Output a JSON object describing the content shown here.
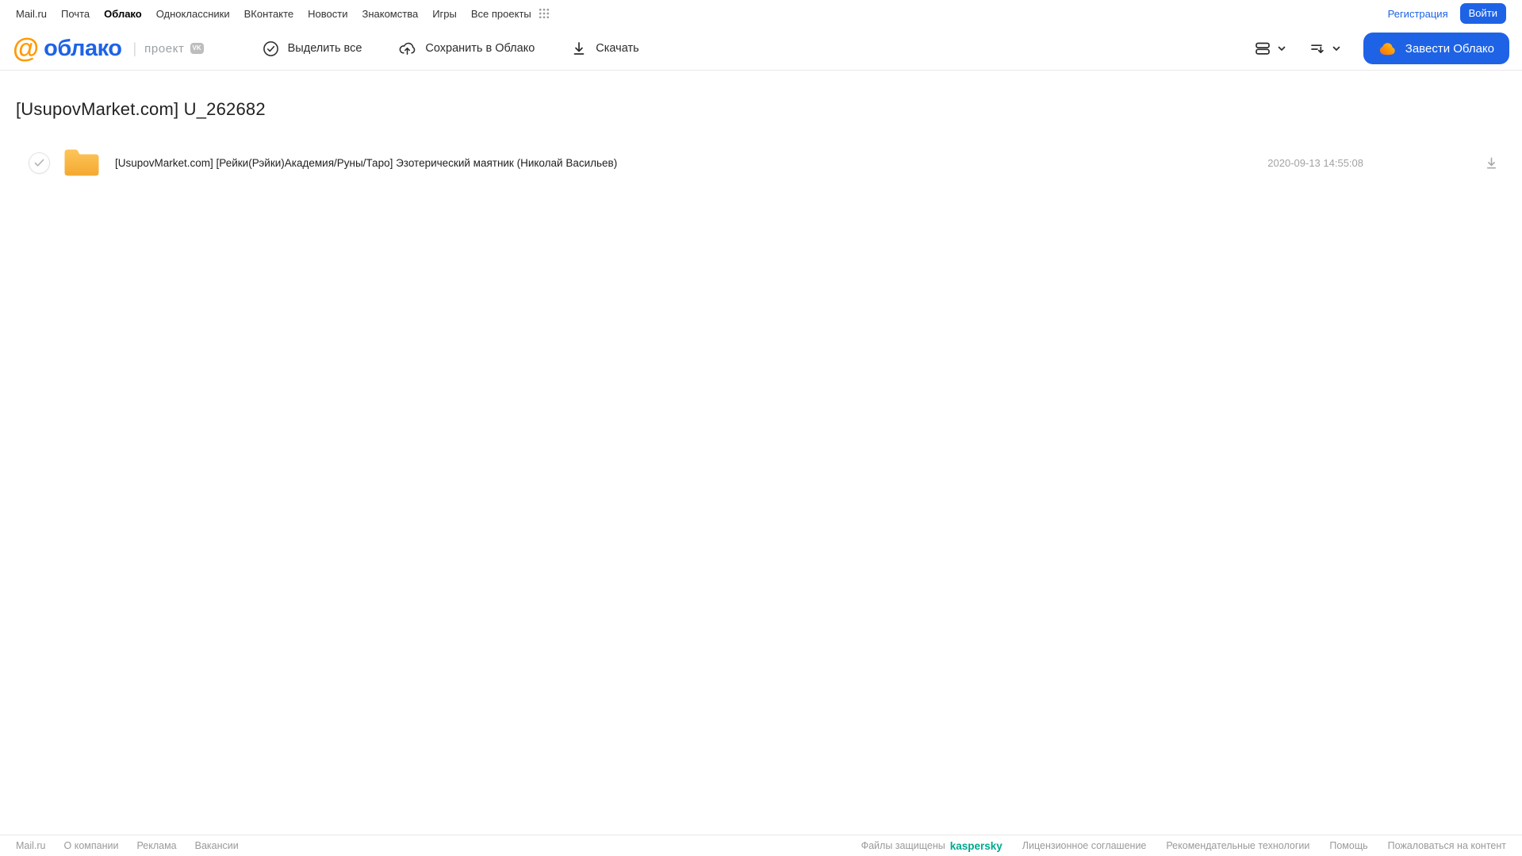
{
  "topnav": {
    "links": [
      {
        "label": "Mail.ru",
        "active": false
      },
      {
        "label": "Почта",
        "active": false
      },
      {
        "label": "Облако",
        "active": true
      },
      {
        "label": "Одноклассники",
        "active": false
      },
      {
        "label": "ВКонтакте",
        "active": false
      },
      {
        "label": "Новости",
        "active": false
      },
      {
        "label": "Знакомства",
        "active": false
      },
      {
        "label": "Игры",
        "active": false
      },
      {
        "label": "Все проекты",
        "active": false
      }
    ],
    "registration_label": "Регистрация",
    "login_label": "Войти"
  },
  "header": {
    "logo_at": "@",
    "logo_text": "облако",
    "project_label": "проект",
    "vk_badge": "VK",
    "actions": [
      {
        "label": "Выделить все",
        "icon": "check-circle-icon"
      },
      {
        "label": "Сохранить в Облако",
        "icon": "cloud-upload-icon"
      },
      {
        "label": "Скачать",
        "icon": "download-icon"
      }
    ],
    "create_cloud_label": "Завести Облако"
  },
  "main": {
    "title": "[UsupovMarket.com] U_262682",
    "file": {
      "type": "folder",
      "name": "[UsupovMarket.com] [Рейки(Рэйки)Академия/Руны/Таро] Эзотерический маятник (Николай Васильев)",
      "date": "2020-09-13 14:55:08"
    }
  },
  "footer": {
    "links_left": [
      "Mail.ru",
      "О компании",
      "Реклама",
      "Вакансии"
    ],
    "protected_label": "Файлы защищены",
    "kaspersky_label": "kaspersky",
    "links_right": [
      "Лицензионное соглашение",
      "Рекомендательные технологии",
      "Помощь",
      "Пожаловаться на контент"
    ]
  },
  "colors": {
    "accent_blue": "#1E63E6",
    "brand_orange": "#FF9A00",
    "folder_yellow": "#F5A933",
    "kaspersky_green": "#00A88E"
  }
}
